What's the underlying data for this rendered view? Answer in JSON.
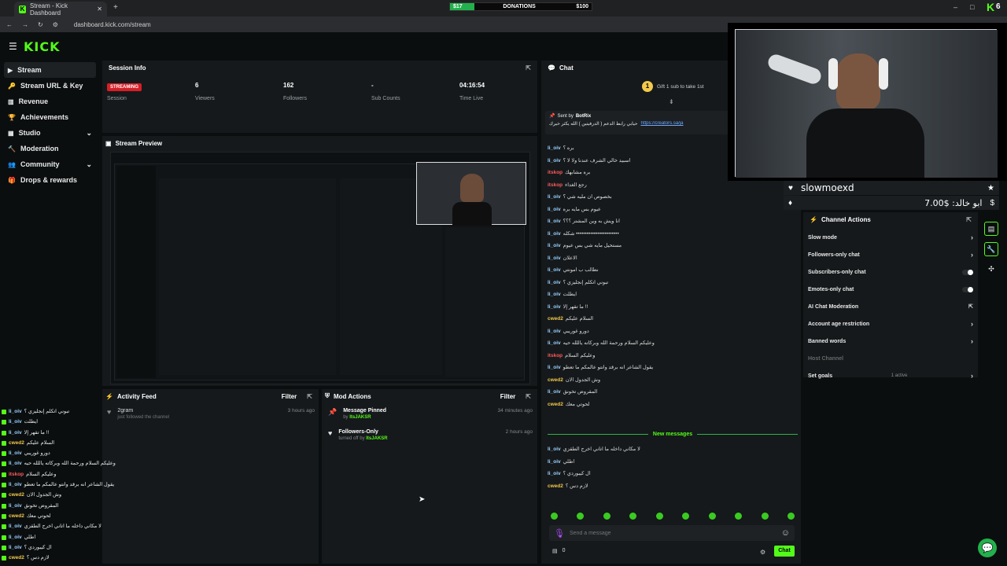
{
  "browser": {
    "tab_title": "Stream - Kick Dashboard",
    "url": "dashboard.kick.com/stream"
  },
  "donations": {
    "left": "$17",
    "label": "DONATIONS",
    "right": "$100",
    "progress": 0.17
  },
  "brand": {
    "logo": "KICK",
    "accent": "#53fc18"
  },
  "sidebar": {
    "items": [
      {
        "label": "Stream",
        "icon": "play-icon"
      },
      {
        "label": "Stream URL & Key",
        "icon": "key-icon"
      },
      {
        "label": "Revenue",
        "icon": "revenue-icon"
      },
      {
        "label": "Achievements",
        "icon": "trophy-icon"
      },
      {
        "label": "Studio",
        "icon": "studio-icon"
      },
      {
        "label": "Moderation",
        "icon": "hammer-icon"
      },
      {
        "label": "Community",
        "icon": "community-icon"
      },
      {
        "label": "Drops & rewards",
        "icon": "gift-icon"
      }
    ]
  },
  "session": {
    "title": "Session Info",
    "badge": "STREAMING",
    "stats": [
      {
        "value": "",
        "label": "Session"
      },
      {
        "value": "6",
        "label": "Viewers"
      },
      {
        "value": "162",
        "label": "Followers"
      },
      {
        "value": "-",
        "label": "Sub Counts"
      },
      {
        "value": "04:16:54",
        "label": "Time Live"
      }
    ]
  },
  "preview": {
    "title": "Stream Preview"
  },
  "activity": {
    "title": "Activity Feed",
    "filter": "Filter",
    "items": [
      {
        "user": "2gram",
        "text": "just followed the channel",
        "time": "3 hours ago"
      }
    ]
  },
  "mod": {
    "title": "Mod Actions",
    "filter": "Filter",
    "items": [
      {
        "title": "Message Pinned",
        "by": "by",
        "user": "ItsJAKSR",
        "time": "34 minutes ago"
      },
      {
        "title": "Followers-Only",
        "by": "turned off by",
        "user": "ItsJAKSR",
        "time": "2 hours ago"
      }
    ]
  },
  "chat": {
    "title": "Chat",
    "gift": "Gift 1 sub to take 1st",
    "pinned_sender": "Sent by",
    "pinned_user": "BotRix",
    "pinned_text": "حيابي رابط الدعم ( الدرفيتين ) الله يكثر خيرك",
    "pinned_link": "https://creators.sa/ja",
    "messages": [
      {
        "user": "li_oiv",
        "color": "#9ad1ff",
        "text": "بره ؟"
      },
      {
        "user": "li_oiv",
        "color": "#9ad1ff",
        "text": "اسبيد خالي الشرف عندنا ولا لا ؟"
      },
      {
        "user": "itskop",
        "color": "#ff5a5a",
        "text": "بره مشابهك"
      },
      {
        "user": "itskop",
        "color": "#ff5a5a",
        "text": "رجع الغداء"
      },
      {
        "user": "li_oiv",
        "color": "#9ad1ff",
        "text": "بخصوص ان مليه شي ؟"
      },
      {
        "user": "li_oiv",
        "color": "#9ad1ff",
        "text": "عيوم بس مايه بره"
      },
      {
        "user": "li_oiv",
        "color": "#9ad1ff",
        "text": "انا ويش به وين المشتر ؟؟؟"
      },
      {
        "user": "li_oiv",
        "color": "#9ad1ff",
        "text": "شكله ••••••••••••••••••••••••"
      },
      {
        "user": "li_oiv",
        "color": "#9ad1ff",
        "text": "مستحيل مايه شي بس عيوم"
      },
      {
        "user": "li_oiv",
        "color": "#9ad1ff",
        "text": "الاعلان"
      },
      {
        "user": "li_oiv",
        "color": "#9ad1ff",
        "text": "نطالب ب امونتي"
      },
      {
        "user": "li_oiv",
        "color": "#9ad1ff",
        "text": "تبوني اتكلم إنجليزي ؟"
      },
      {
        "user": "li_oiv",
        "color": "#9ad1ff",
        "text": "ايطلت"
      },
      {
        "user": "li_oiv",
        "color": "#9ad1ff",
        "text": "ما تقهر إلا !!"
      },
      {
        "user": "cwed2",
        "color": "#f2c94c",
        "text": "السلام عليكم"
      },
      {
        "user": "li_oiv",
        "color": "#9ad1ff",
        "text": "دورو غوريبي"
      },
      {
        "user": "li_oiv",
        "color": "#9ad1ff",
        "text": "وعليكم السلام ورحمة الله وبركاته ياللله حيه"
      },
      {
        "user": "itskop",
        "color": "#ff5a5a",
        "text": "وعليكم السلام"
      },
      {
        "user": "li_oiv",
        "color": "#9ad1ff",
        "text": "يقول الشاعر انه برقد وانتو عالمكم ما تعطو"
      },
      {
        "user": "cwed2",
        "color": "#f2c94c",
        "text": "وش الجدول الان"
      },
      {
        "user": "li_oiv",
        "color": "#9ad1ff",
        "text": "المقروض تخونق"
      },
      {
        "user": "cwed2",
        "color": "#f2c94c",
        "text": "لحوتي معك"
      }
    ],
    "new_messages": "New messages",
    "new": [
      {
        "user": "li_oiv",
        "color": "#9ad1ff",
        "text": "لا مكاني داخله ما اتاني اخرج الطقزي"
      },
      {
        "user": "li_oiv",
        "color": "#9ad1ff",
        "text": "اطلي"
      },
      {
        "user": "li_oiv",
        "color": "#9ad1ff",
        "text": "ال كيبوردي ؟"
      },
      {
        "user": "cwed2",
        "color": "#f2c94c",
        "text": "لازم دس ؟"
      }
    ],
    "placeholder": "Send a message",
    "count": "0",
    "send": "Chat"
  },
  "overlay": {
    "username": "slowmoexd",
    "donation_text": "ابو خالد: $7.00"
  },
  "channel_actions": {
    "title": "Channel Actions",
    "items": [
      {
        "label": "Slow mode",
        "type": "chevron"
      },
      {
        "label": "Followers-only chat",
        "type": "chevron"
      },
      {
        "label": "Subscribers-only chat",
        "type": "toggle"
      },
      {
        "label": "Emotes-only chat",
        "type": "toggle"
      },
      {
        "label": "AI Chat Moderation",
        "type": "external"
      },
      {
        "label": "Account age restriction",
        "type": "chevron"
      },
      {
        "label": "Banned words",
        "type": "chevron"
      },
      {
        "label": "Host Channel",
        "type": "disabled"
      },
      {
        "label": "Set goals",
        "type": "chevron",
        "extra": "1 active"
      }
    ]
  },
  "side_feed": [
    {
      "user": "li_oiv",
      "color": "#9ad1ff",
      "text": "تبوني اتكلم إنجليزي ؟"
    },
    {
      "user": "li_oiv",
      "color": "#9ad1ff",
      "text": "ايطلت"
    },
    {
      "user": "li_oiv",
      "color": "#9ad1ff",
      "text": "ما تقهر إلا !!"
    },
    {
      "user": "cwed2",
      "color": "#f2c94c",
      "text": "السلام عليكم"
    },
    {
      "user": "li_oiv",
      "color": "#9ad1ff",
      "text": "دورو غوريبي"
    },
    {
      "user": "li_oiv",
      "color": "#9ad1ff",
      "text": "وعليكم السلام ورحمة الله وبركاته ياللله حيه"
    },
    {
      "user": "itskop",
      "color": "#ff5a5a",
      "text": "وعليكم السلام"
    },
    {
      "user": "li_oiv",
      "color": "#9ad1ff",
      "text": "يقول الشاعر انه برقد وانتو عالمكم ما تعطو"
    },
    {
      "user": "cwed2",
      "color": "#f2c94c",
      "text": "وش الجدول الان"
    },
    {
      "user": "li_oiv",
      "color": "#9ad1ff",
      "text": "المقروض تخونق"
    },
    {
      "user": "cwed2",
      "color": "#f2c94c",
      "text": "لحوتي معك"
    },
    {
      "user": "li_oiv",
      "color": "#9ad1ff",
      "text": "لا مكاني داخله ما اتاني اخرج الطقزي"
    },
    {
      "user": "li_oiv",
      "color": "#9ad1ff",
      "text": "اطلي"
    },
    {
      "user": "li_oiv",
      "color": "#9ad1ff",
      "text": "ال كيبوردي ؟"
    },
    {
      "user": "cwed2",
      "color": "#f2c94c",
      "text": "لازم دس ؟"
    }
  ]
}
